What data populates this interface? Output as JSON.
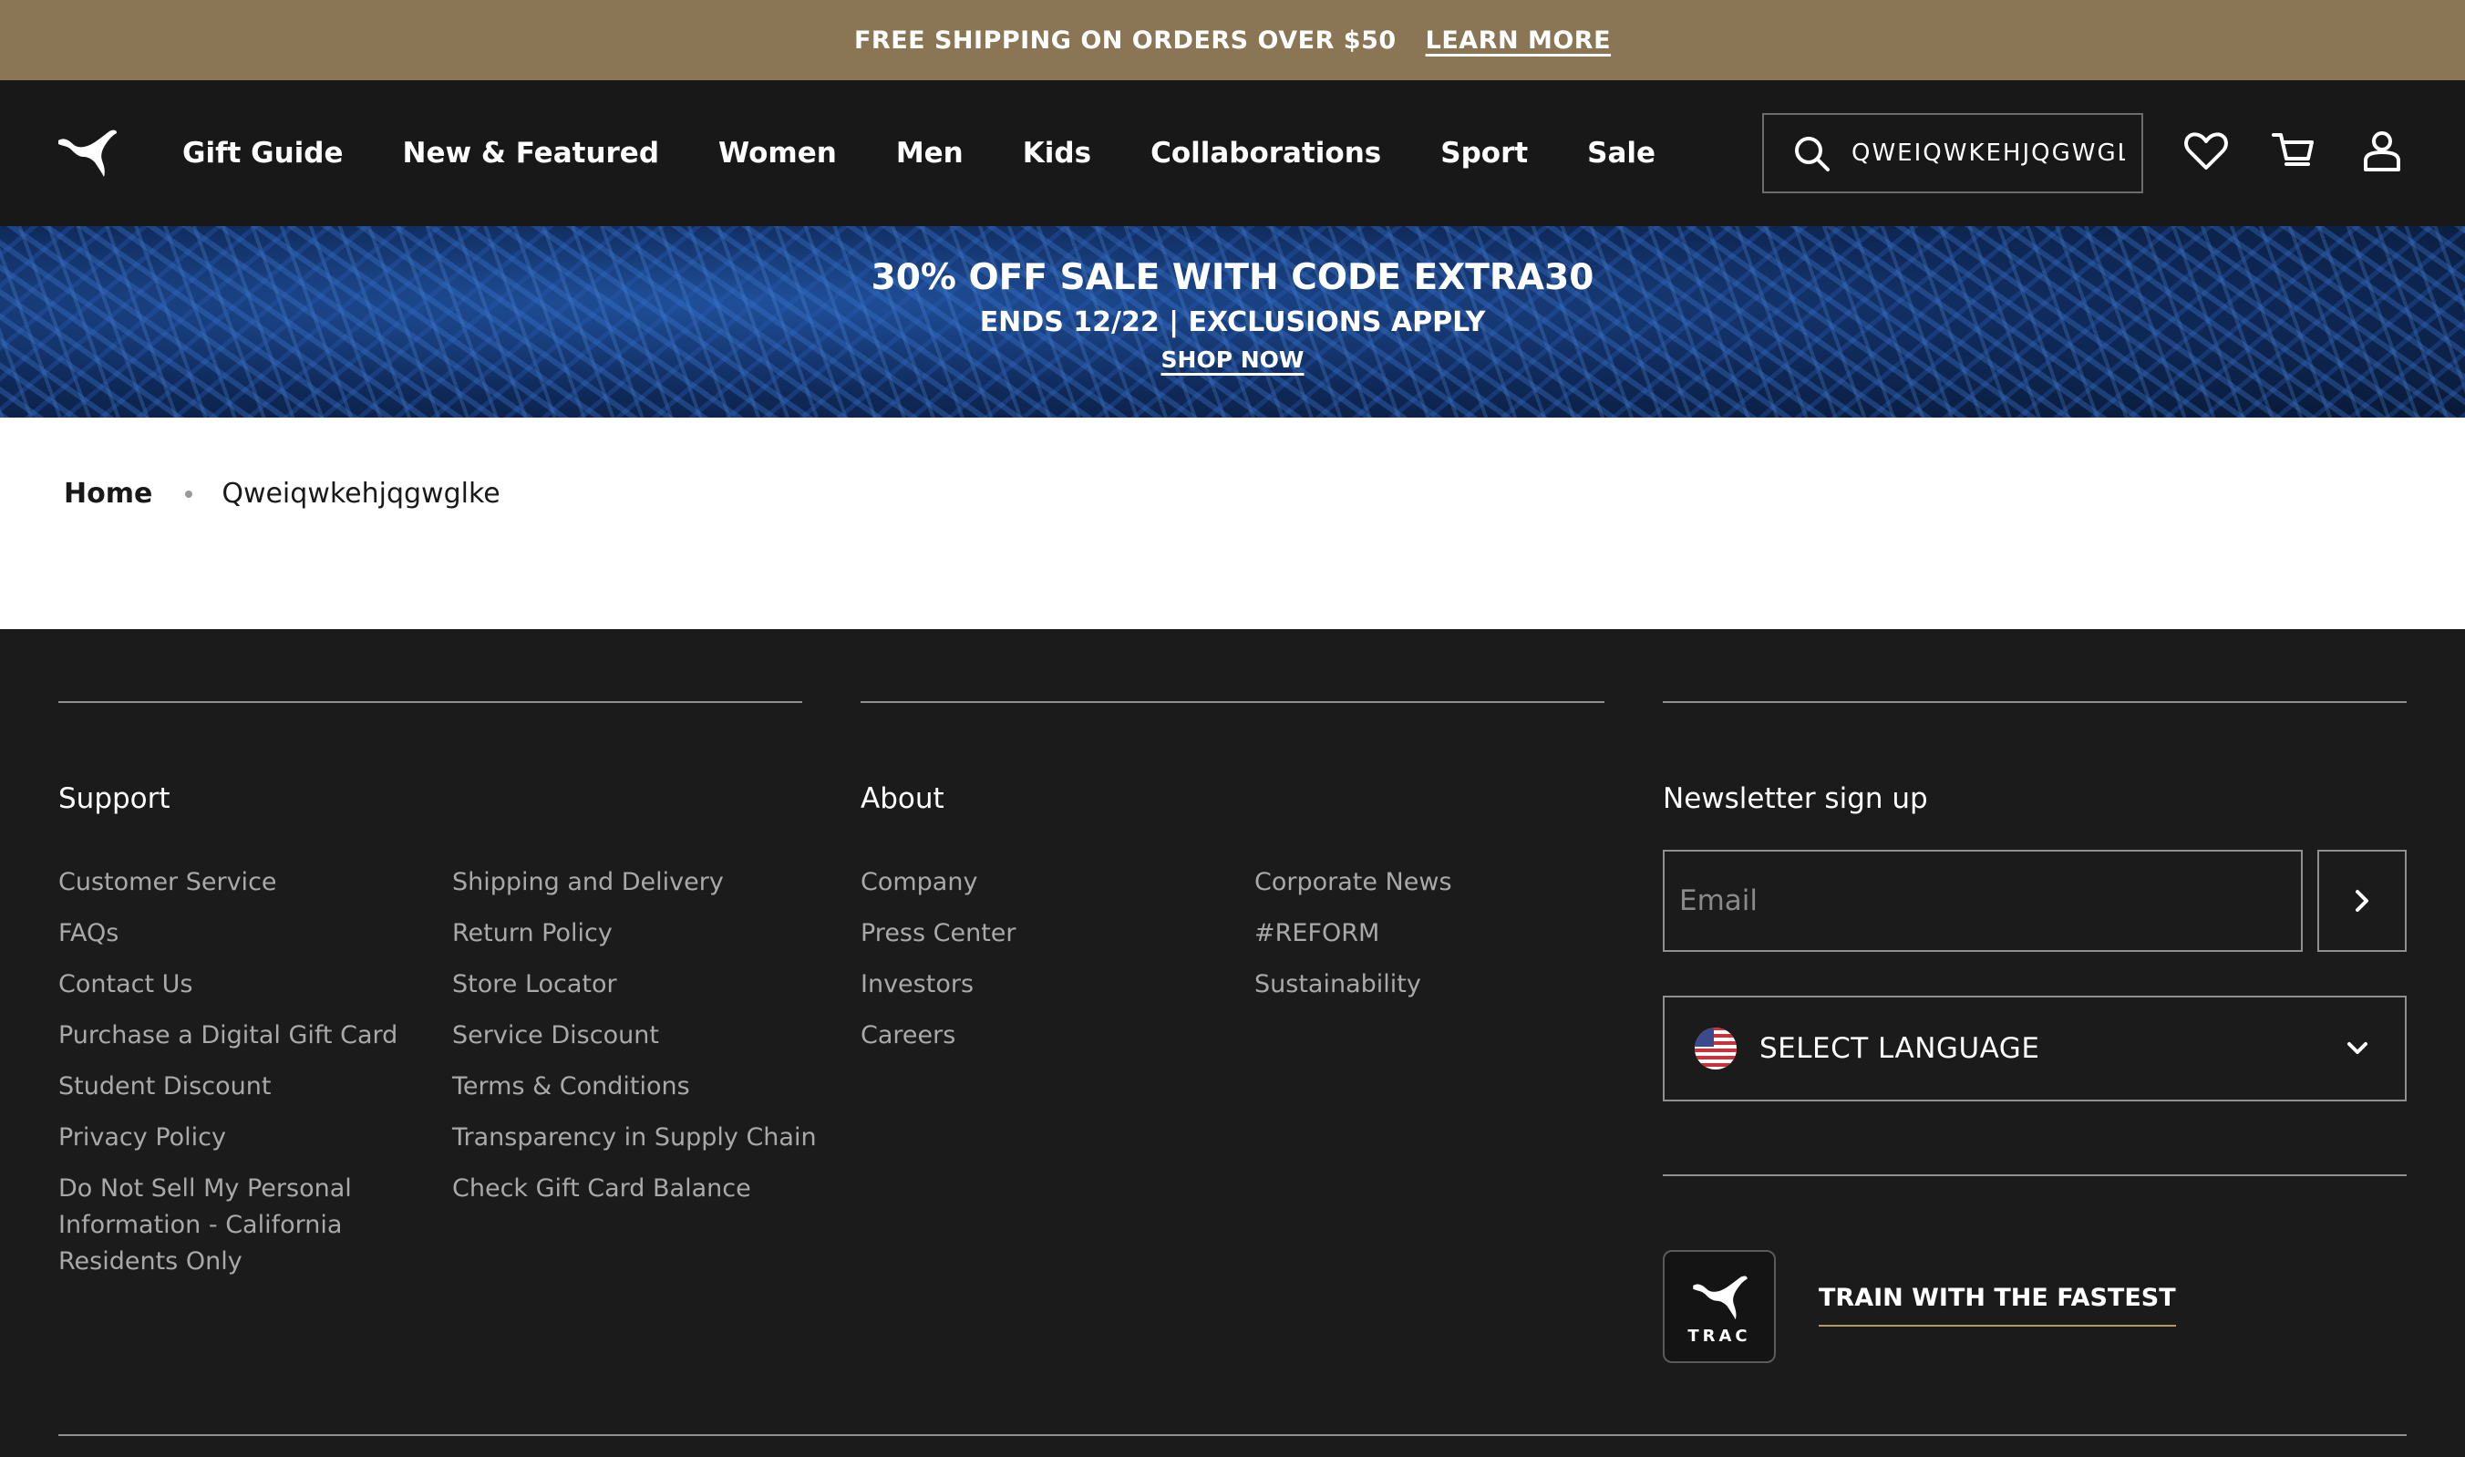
{
  "promo_bar": {
    "text": "FREE SHIPPING ON ORDERS OVER $50",
    "link": "LEARN MORE",
    "bg_color": "#8a7654"
  },
  "header": {
    "logo": "puma-logo",
    "nav": [
      "Gift Guide",
      "New & Featured",
      "Women",
      "Men",
      "Kids",
      "Collaborations",
      "Sport",
      "Sale"
    ],
    "search_value": "QWEIQWKEHJQGWGL",
    "icons": [
      "search-icon",
      "heart-icon",
      "cart-icon",
      "user-icon"
    ]
  },
  "hero": {
    "line1": "30% OFF SALE WITH CODE EXTRA30",
    "line2": "ENDS 12/22 | EXCLUSIONS APPLY",
    "cta": "SHOP NOW"
  },
  "breadcrumb": {
    "home": "Home",
    "current": "Qweiqwkehjqgwglke"
  },
  "footer": {
    "support": {
      "title": "Support",
      "col1": [
        "Customer Service",
        "FAQs",
        "Contact Us",
        "Purchase a Digital Gift Card",
        "Student Discount",
        "Privacy Policy",
        "Do Not Sell My Personal",
        "Information - California",
        "Residents Only"
      ],
      "col2": [
        "Shipping and Delivery",
        "Return Policy",
        "Store Locator",
        "Service Discount",
        "Terms & Conditions",
        "Transparency in Supply Chain",
        "Check Gift Card Balance"
      ]
    },
    "about": {
      "title": "About",
      "col1": [
        "Company",
        "Press Center",
        "Investors",
        "Careers"
      ],
      "col2": [
        "Corporate News",
        "#REFORM",
        "Sustainability"
      ]
    },
    "newsletter": {
      "title": "Newsletter sign up",
      "email_placeholder": "Email",
      "language_label": "SELECT LANGUAGE",
      "trac_word": "TRAC",
      "trac_cta": "TRAIN WITH THE FASTEST",
      "accent_color": "#b59a5f"
    }
  }
}
